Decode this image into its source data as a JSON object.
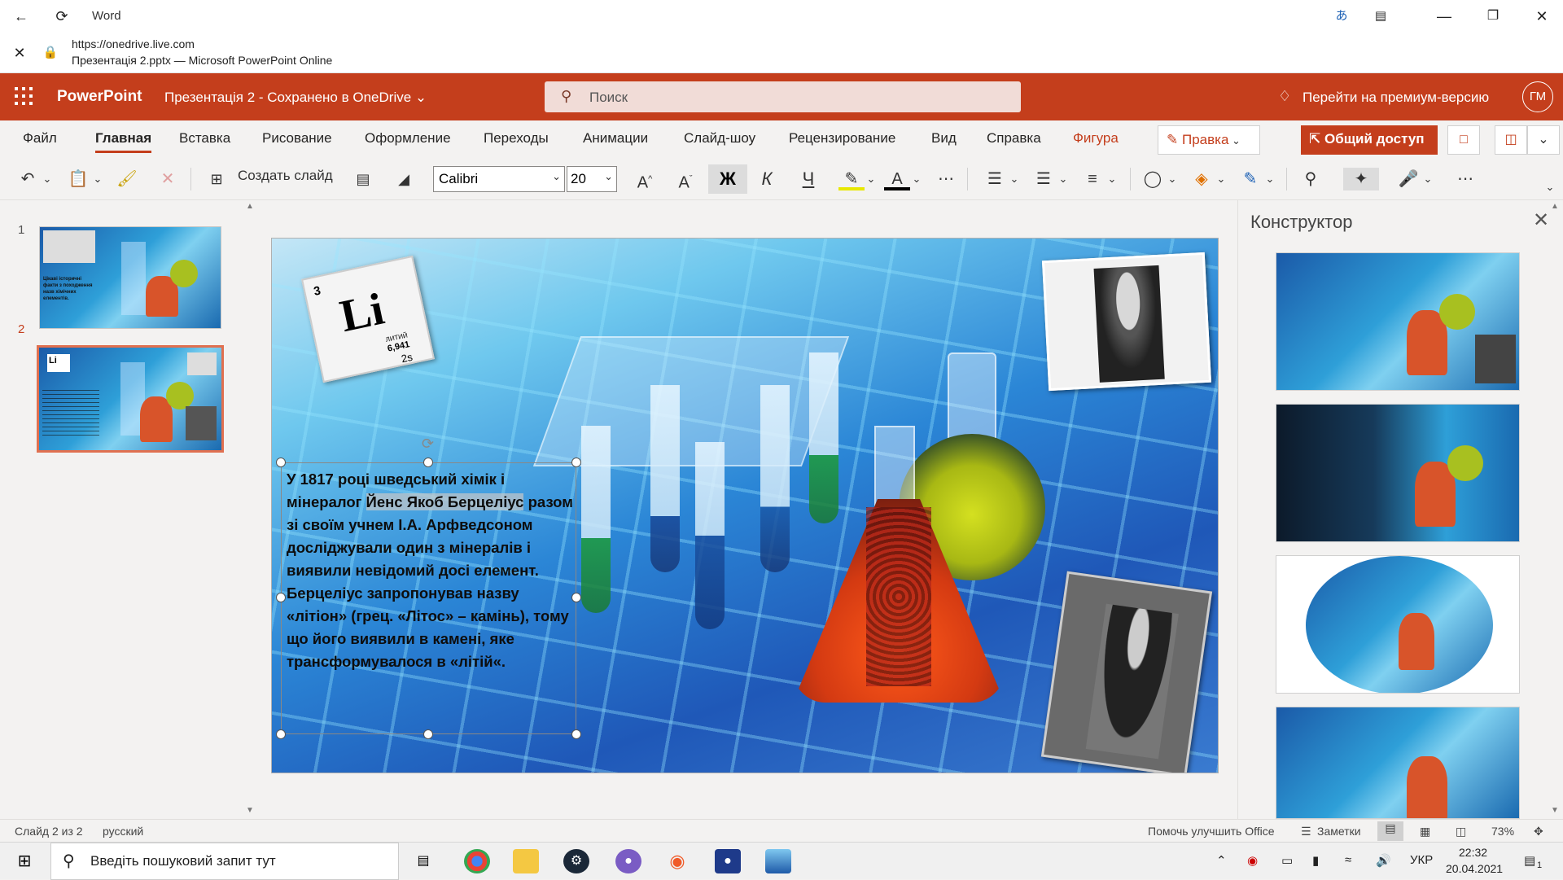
{
  "window": {
    "title": "Word",
    "url": "https://onedrive.live.com",
    "page_title": "Презентація 2.pptx — Microsoft PowerPoint Online"
  },
  "appbar": {
    "brand": "PowerPoint",
    "document": "Презентація 2 - Сохранено в OneDrive ⌄",
    "search_placeholder": "Поиск",
    "premium": "Перейти на премиум-версию",
    "avatar_initials": "ГМ",
    "accent_color": "#c43e1c"
  },
  "ribbon": {
    "tabs": [
      "Файл",
      "Главная",
      "Вставка",
      "Рисование",
      "Оформление",
      "Переходы",
      "Анимации",
      "Слайд-шоу",
      "Рецензирование",
      "Вид",
      "Справка",
      "Фигура"
    ],
    "active_tab": "Главная",
    "edit_button": "Правка",
    "share_button": "Общий доступ",
    "new_slide": "Создать слайд",
    "font_name": "Calibri",
    "font_size": "20",
    "bold_glyph": "Ж",
    "italic_glyph": "К",
    "underline_glyph": "Ч"
  },
  "thumbnails": [
    {
      "number": "1",
      "caption": "Цікаві історичні факти з походження назв хімічних елементів."
    },
    {
      "number": "2",
      "caption": "Li"
    }
  ],
  "slide": {
    "element_symbol": "Li",
    "element_number": "3",
    "element_name": "ЛИТИЙ",
    "element_mass": "6,941",
    "element_config": "2s",
    "text_part1": " У 1817 році шведський хімік і мінералог ",
    "text_highlight": "Йенс Якоб Берцеліус",
    "text_part2": " разом зі своїм учнем І.А. Арфведсоном досліджували один з мінералів і виявили невідомий досі елемент. Берцеліус запропонував назву «літіон» (грец. «Літос» – камінь), тому що його виявили в камені, яке трансформувалося в «літій«."
  },
  "designer": {
    "title": "Конструктор"
  },
  "status": {
    "slide_of": "Слайд 2 из 2",
    "language": "русский",
    "help": "Помочь улучшить Office",
    "notes": "Заметки",
    "zoom": "73%"
  },
  "taskbar": {
    "search_placeholder": "Введіть пошуковий запит тут",
    "lang": "УКР",
    "time": "22:32",
    "date": "20.04.2021",
    "notifications": "1"
  }
}
